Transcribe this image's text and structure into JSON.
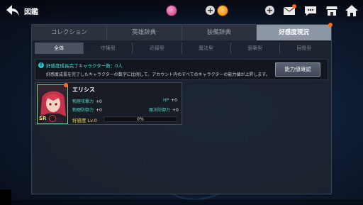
{
  "header": {
    "title": "図鑑",
    "back_icon": "back-arrow-icon",
    "resources": [
      {
        "icon": "pink-gem-icon",
        "color": "#e05aa6"
      },
      {
        "icon": "gold-coin-icon",
        "color": "#f0a020"
      }
    ],
    "plus_label": "+",
    "icons": [
      "mail-icon",
      "chat-icon",
      "shop-icon",
      "home-icon"
    ]
  },
  "tabs": [
    "コレクション",
    "英雄辞典",
    "装備辞典",
    "好感度現況"
  ],
  "active_tab": "好感度現況",
  "subtabs": [
    "全体",
    "守護型",
    "近接型",
    "魔法型",
    "狙撃型",
    "回復型"
  ],
  "active_subtab": "全体",
  "info": {
    "icon": "info-icon",
    "headline": "好感度成長完了キャラクター数：0人",
    "description": "好感度成長を完了したキャラクターの数字に比例して、アカウント内のすべてのキャラクターの能力値が上昇します。",
    "button_label": "能力値確認"
  },
  "character": {
    "name": "エリシス",
    "rarity": "SR",
    "stats": {
      "phys_atk_label": "物理攻撃力",
      "phys_atk_value": "+0",
      "phys_def_label": "物理防御力",
      "phys_def_value": "+0",
      "hp_label": "HP",
      "hp_value": "+0",
      "mag_def_label": "魔法防御力",
      "mag_def_value": "+0"
    },
    "affection_label": "好感度 Lv.0",
    "affection_percent_text": "0％",
    "affection_percent": 0
  },
  "colors": {
    "accent_cyan": "#3fe0d6",
    "affection_yellow": "#f5d84a",
    "notification": "#ff6a1a"
  }
}
